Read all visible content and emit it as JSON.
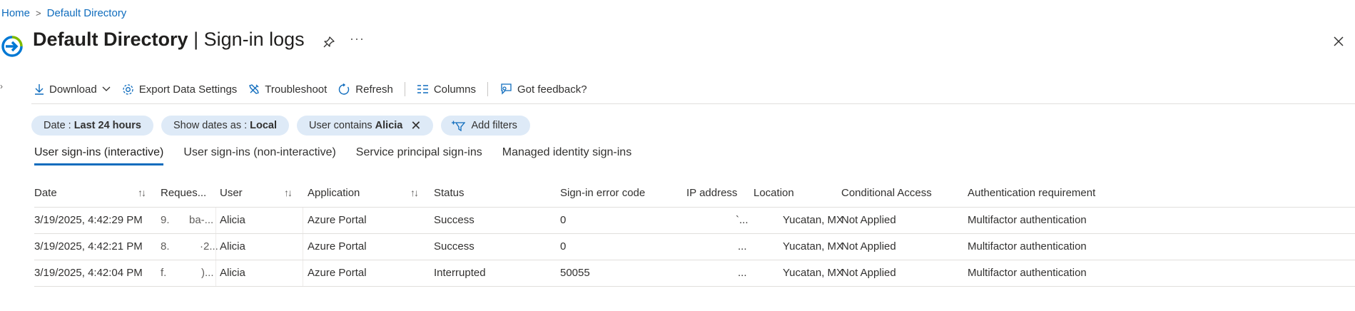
{
  "breadcrumb": {
    "home": "Home",
    "separator": ">",
    "directory": "Default Directory"
  },
  "header": {
    "title_bold": "Default Directory",
    "title_sep": " | ",
    "title_rest": "Sign-in logs",
    "more_glyph": "···",
    "logo_icon": "azure-ad-signin-icon",
    "pin_icon": "pin-icon",
    "close_icon": "close-icon"
  },
  "toolbar": {
    "download": "Download",
    "export": "Export Data Settings",
    "troubleshoot": "Troubleshoot",
    "refresh": "Refresh",
    "columns": "Columns",
    "feedback": "Got feedback?"
  },
  "filters": {
    "date_label": "Date :",
    "date_value": "Last 24 hours",
    "show_dates_label": "Show dates as :",
    "show_dates_value": "Local",
    "user_label": "User contains",
    "user_value": "Alicia",
    "add_filters": "Add filters"
  },
  "tabs": [
    {
      "label": "User sign-ins (interactive)",
      "active": true
    },
    {
      "label": "User sign-ins (non-interactive)"
    },
    {
      "label": "Service principal sign-ins"
    },
    {
      "label": "Managed identity sign-ins"
    }
  ],
  "table": {
    "columns": {
      "date": "Date",
      "request": "Reques...",
      "user": "User",
      "application": "Application",
      "status": "Status",
      "error_code": "Sign-in error code",
      "ip": "IP address",
      "location": "Location",
      "conditional_access": "Conditional Access",
      "auth_requirement": "Authentication requirement"
    },
    "sort_glyph": "↑↓",
    "rows": [
      {
        "date": "3/19/2025, 4:42:29 PM",
        "req_a": "9.",
        "req_b": "ba-...",
        "user": "Alicia",
        "application": "Azure Portal",
        "status": "Success",
        "error_code": "0",
        "ip": "`...",
        "location": "Yucatan, MX",
        "conditional_access": "Not Applied",
        "auth_requirement": "Multifactor authentication"
      },
      {
        "date": "3/19/2025, 4:42:21 PM",
        "req_a": "8.",
        "req_b": "·2...",
        "user": "Alicia",
        "application": "Azure Portal",
        "status": "Success",
        "error_code": "0",
        "ip": "...",
        "location": "Yucatan, MX",
        "conditional_access": "Not Applied",
        "auth_requirement": "Multifactor authentication"
      },
      {
        "date": "3/19/2025, 4:42:04 PM",
        "req_a": "f.",
        "req_b": ")...",
        "user": "Alicia",
        "application": "Azure Portal",
        "status": "Interrupted",
        "error_code": "50055",
        "ip": "...",
        "location": "Yucatan, MX",
        "conditional_access": "Not Applied",
        "auth_requirement": "Multifactor authentication"
      }
    ]
  },
  "colors": {
    "accent": "#0f6cbd",
    "pill_bg": "#deeaf7",
    "text": "#323130",
    "divider": "#e1dfdd"
  }
}
